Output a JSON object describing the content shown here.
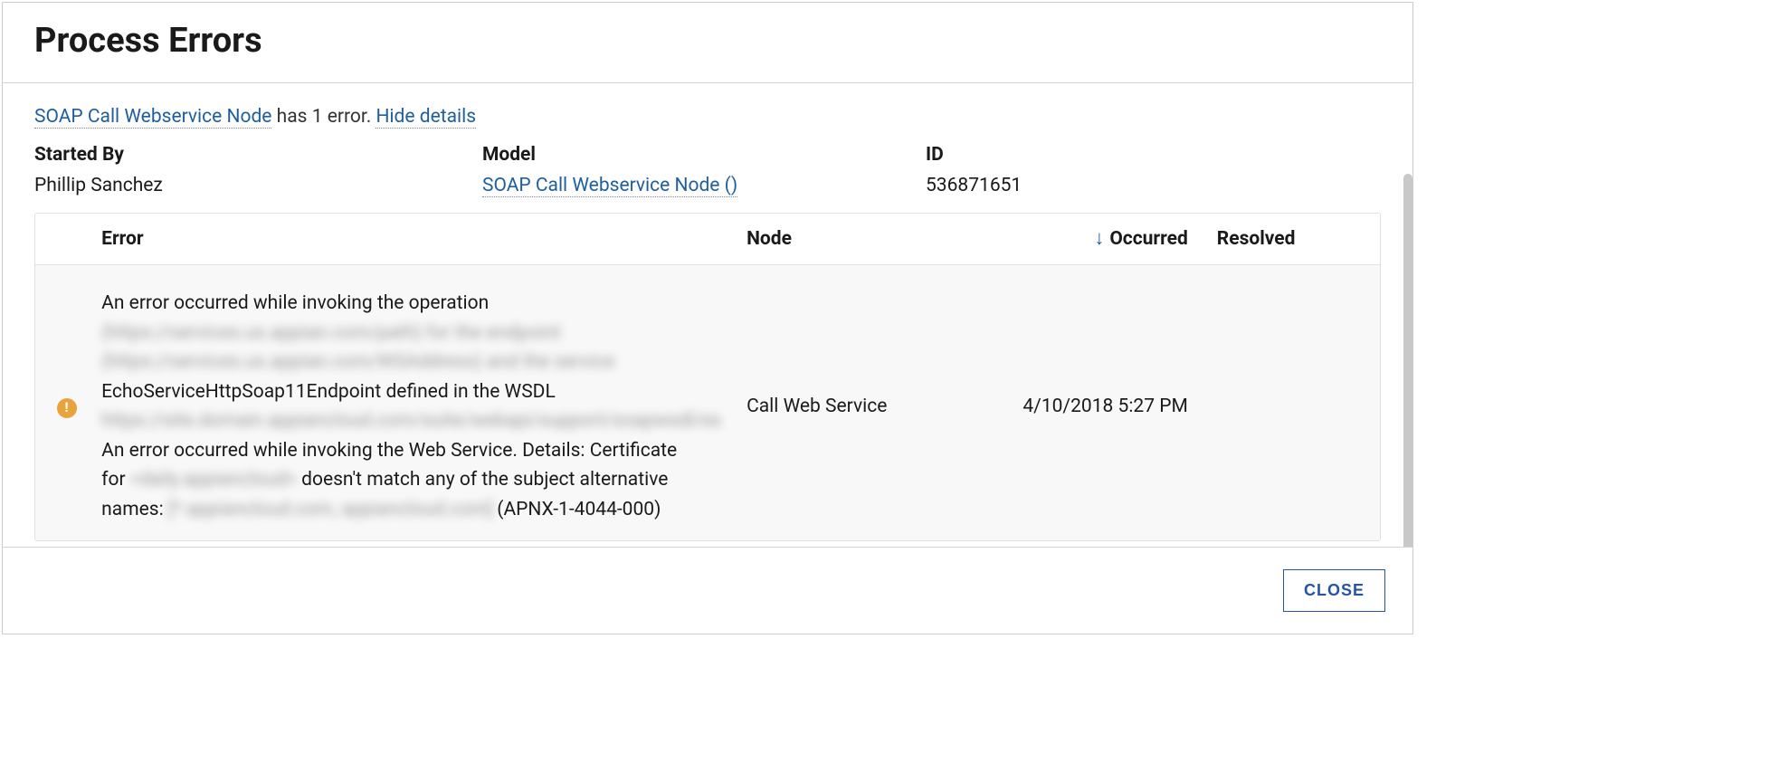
{
  "dialog": {
    "title": "Process Errors",
    "close_label": "CLOSE"
  },
  "summary": {
    "link_text": "SOAP Call Webservice Node",
    "mid_text": " has 1 error. ",
    "hide_link": "Hide details"
  },
  "info": {
    "started_by_label": "Started By",
    "started_by_value": "Phillip Sanchez",
    "model_label": "Model",
    "model_link": "SOAP Call Webservice Node ()",
    "id_label": "ID",
    "id_value": "536871651"
  },
  "table": {
    "headers": {
      "error": "Error",
      "node": "Node",
      "occurred": "Occurred",
      "resolved": "Resolved"
    },
    "sort_column": "occurred",
    "sort_direction": "desc",
    "rows": [
      {
        "icon": "warning",
        "error": {
          "line1": "An error occurred while invoking the operation",
          "blur1": "(https://services.us.appian.com/path) for the endpoint",
          "blur2": "(https://services.us.appian.com/WSAddress) and the service",
          "line2": "EchoServiceHttpSoap11Endpoint defined in the WSDL",
          "blur3": "https://site.domain.appiancloud.com/suite/webapi/support/soapwsdl/es",
          "line3a": "An error occurred while invoking the Web Service. Details: Certificate",
          "line3b_prefix": "for ",
          "blur4": "<daily.appiancloud>",
          "line3b_suffix": " doesn't match any of the subject alternative",
          "line4_prefix": "names: ",
          "blur5": "[*.appiancloud.com, appiancloud.com]",
          "line4_suffix": " (APNX-1-4044-000)"
        },
        "node": "Call Web Service",
        "occurred": "4/10/2018 5:27 PM",
        "resolved": ""
      }
    ]
  }
}
